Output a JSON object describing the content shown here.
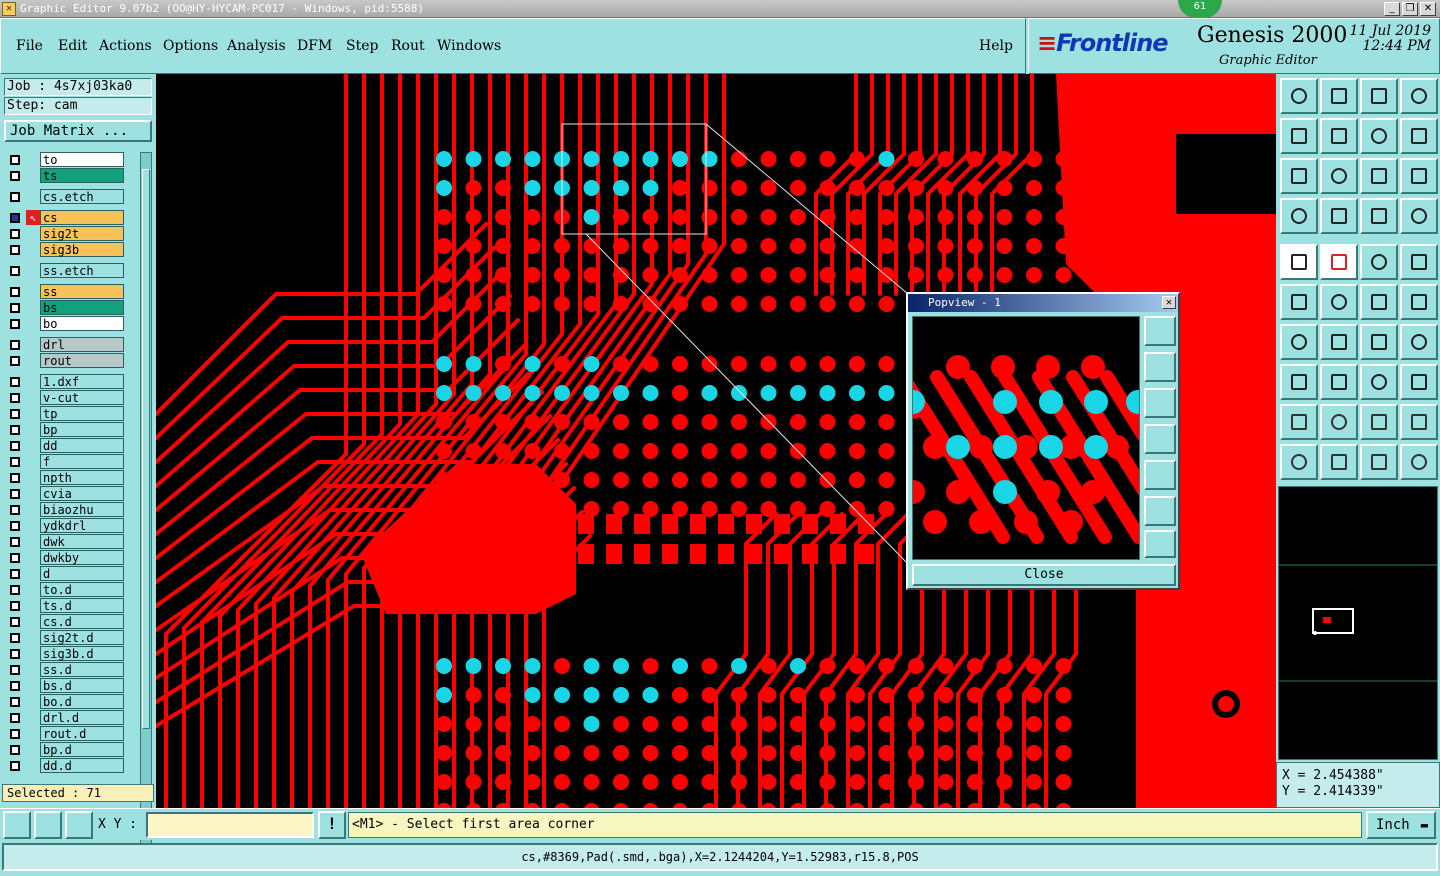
{
  "window": {
    "title": "Graphic Editor 9.07b2 (OO@HY-HYCAM-PC017 - Windows, pid:5588)",
    "badge": "61"
  },
  "menu": [
    "File",
    "Edit",
    "Actions",
    "Options",
    "Analysis",
    "DFM",
    "Step",
    "Rout",
    "Windows"
  ],
  "help_label": "Help",
  "brand": {
    "logo": "Frontline",
    "product": "Genesis 2000",
    "subtitle": "Graphic Editor",
    "date": "11 Jul 2019",
    "time": "12:44 PM"
  },
  "job": {
    "job_line": "Job : 4s7xj03ka0",
    "step_line": "Step: cam",
    "matrix_button": "Job Matrix ..."
  },
  "layers": [
    {
      "name": "to",
      "color": "#ffffff",
      "gap": false
    },
    {
      "name": "ts",
      "color": "#14a07a",
      "gap": false
    },
    {
      "name": "cs.etch",
      "color": "#9ee1e1",
      "gap": true
    },
    {
      "name": "cs",
      "color": "#f8c25a",
      "gap": true,
      "active": true
    },
    {
      "name": "sig2t",
      "color": "#f8c25a",
      "gap": false
    },
    {
      "name": "sig3b",
      "color": "#f8c25a",
      "gap": false
    },
    {
      "name": "ss.etch",
      "color": "#9ee1e1",
      "gap": true
    },
    {
      "name": "ss",
      "color": "#f8c25a",
      "gap": true
    },
    {
      "name": "bs",
      "color": "#14a07a",
      "gap": false
    },
    {
      "name": "bo",
      "color": "#ffffff",
      "gap": false
    },
    {
      "name": "drl",
      "color": "#b8c8c8",
      "gap": true
    },
    {
      "name": "rout",
      "color": "#b8c8c8",
      "gap": false
    },
    {
      "name": "1.dxf",
      "color": "#9ee1e1",
      "gap": true
    },
    {
      "name": "v-cut",
      "color": "#9ee1e1",
      "gap": false
    },
    {
      "name": "tp",
      "color": "#9ee1e1",
      "gap": false
    },
    {
      "name": "bp",
      "color": "#9ee1e1",
      "gap": false
    },
    {
      "name": "dd",
      "color": "#9ee1e1",
      "gap": false
    },
    {
      "name": "f",
      "color": "#9ee1e1",
      "gap": false
    },
    {
      "name": "npth",
      "color": "#9ee1e1",
      "gap": false
    },
    {
      "name": "cvia",
      "color": "#9ee1e1",
      "gap": false
    },
    {
      "name": "biaozhu",
      "color": "#9ee1e1",
      "gap": false
    },
    {
      "name": "ydkdrl",
      "color": "#9ee1e1",
      "gap": false
    },
    {
      "name": "dwk",
      "color": "#9ee1e1",
      "gap": false
    },
    {
      "name": "dwkby",
      "color": "#9ee1e1",
      "gap": false
    },
    {
      "name": "d",
      "color": "#9ee1e1",
      "gap": false
    },
    {
      "name": "to.d",
      "color": "#9ee1e1",
      "gap": false
    },
    {
      "name": "ts.d",
      "color": "#9ee1e1",
      "gap": false
    },
    {
      "name": "cs.d",
      "color": "#9ee1e1",
      "gap": false
    },
    {
      "name": "sig2t.d",
      "color": "#9ee1e1",
      "gap": false
    },
    {
      "name": "sig3b.d",
      "color": "#9ee1e1",
      "gap": false
    },
    {
      "name": "ss.d",
      "color": "#9ee1e1",
      "gap": false
    },
    {
      "name": "bs.d",
      "color": "#9ee1e1",
      "gap": false
    },
    {
      "name": "bo.d",
      "color": "#9ee1e1",
      "gap": false
    },
    {
      "name": "drl.d",
      "color": "#9ee1e1",
      "gap": false
    },
    {
      "name": "rout.d",
      "color": "#9ee1e1",
      "gap": false
    },
    {
      "name": "bp.d",
      "color": "#9ee1e1",
      "gap": false
    },
    {
      "name": "dd.d",
      "color": "#9ee1e1",
      "gap": false
    }
  ],
  "selected": "Selected : 71",
  "popview": {
    "title": "Popview - 1",
    "close_label": "Close"
  },
  "coords": {
    "x": "X = 2.454388\"",
    "y": "Y = 2.414339\""
  },
  "command": {
    "xy_label": "X Y :",
    "xy_value": "",
    "prompt": "<M1> - Select first area corner",
    "units": "Inch"
  },
  "status": "cs,#8369,Pad(.smd,.bga),X=2.1244204,Y=1.52983,r15.8,POS",
  "colors": {
    "copper": "#ff0000",
    "highlight": "#19d6e6",
    "background": "#000000",
    "panel": "#9ee1e1"
  }
}
